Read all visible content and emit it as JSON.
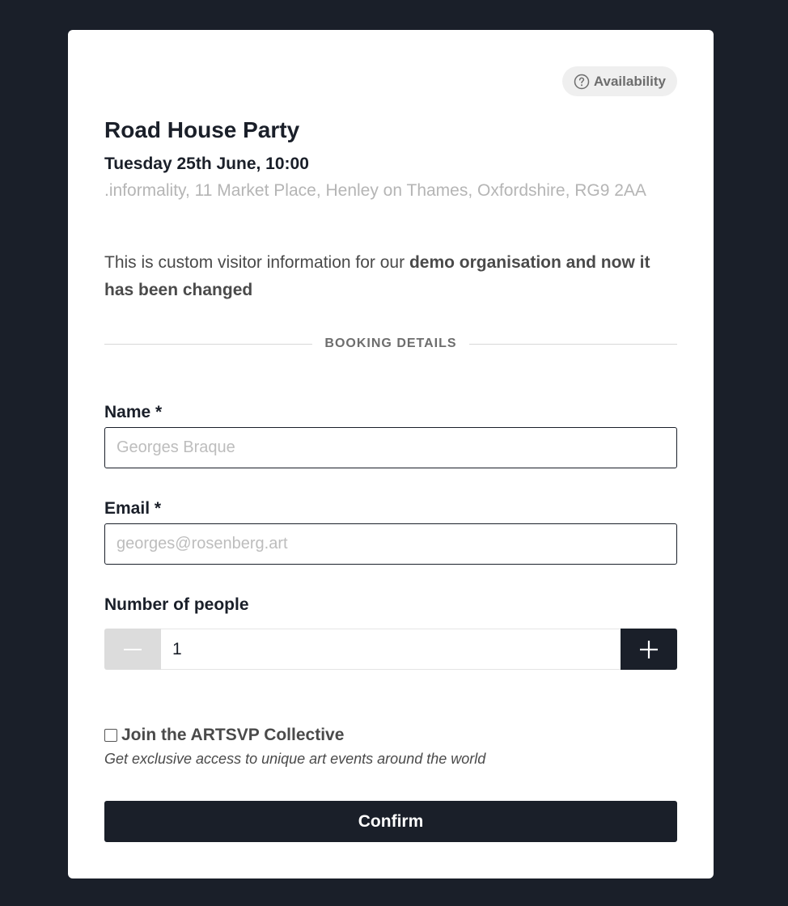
{
  "event": {
    "availability_label": "Availability",
    "title": "Road House Party",
    "datetime": "Tuesday 25th June, 10:00",
    "address": ".informality, 11 Market Place, Henley on Thames, Oxfordshire, RG9 2AA",
    "info_plain": "This is custom visitor information for our ",
    "info_bold": "demo organisation and now it has been changed"
  },
  "section": {
    "booking_details": "BOOKING DETAILS"
  },
  "form": {
    "name_label": "Name *",
    "name_placeholder": "Georges Braque",
    "name_value": "",
    "email_label": "Email *",
    "email_placeholder": "georges@rosenberg.art",
    "email_value": "",
    "people_label": "Number of people",
    "people_value": "1",
    "collective_label": "Join the ARTSVP Collective",
    "collective_checked": false,
    "collective_sub": "Get exclusive access to unique art events around the world",
    "confirm_label": "Confirm"
  },
  "colors": {
    "background": "#1a1f29",
    "accent": "#1a1f29",
    "muted_text": "#b5b5b5"
  },
  "icons": {
    "availability": "question-circle-icon",
    "decrement": "minus-icon",
    "increment": "plus-icon"
  }
}
